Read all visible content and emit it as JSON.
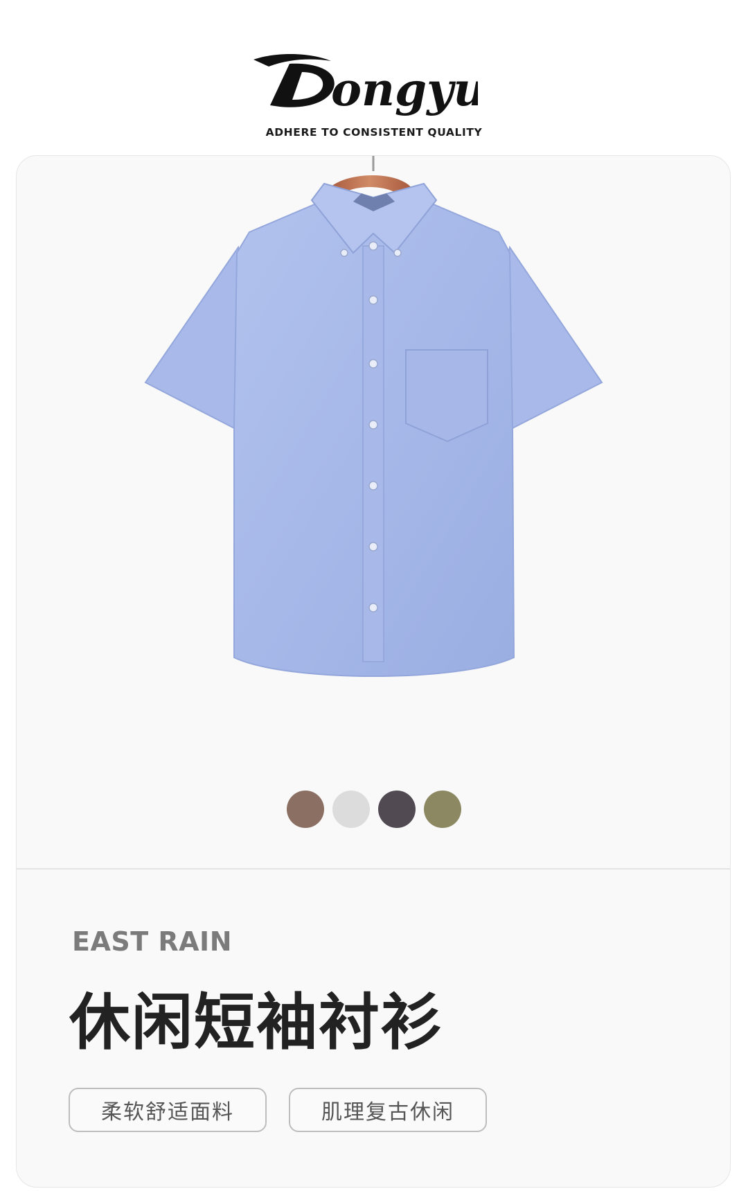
{
  "brand": {
    "name": "Dongyu",
    "tagline": "ADHERE TO CONSISTENT QUALITY"
  },
  "product": {
    "image_icon": "blue-short-sleeve-shirt-on-hanger",
    "shirt_color": "#a4b6e6",
    "swatches": [
      {
        "color": "#8c6f63"
      },
      {
        "color": "#dcdcdc"
      },
      {
        "color": "#524a53"
      },
      {
        "color": "#8c8862"
      }
    ],
    "subtitle_en": "EAST RAIN",
    "title_cn": "休闲短袖衬衫",
    "tags": [
      {
        "label": "柔软舒适面料"
      },
      {
        "label": "肌理复古休闲"
      }
    ]
  }
}
